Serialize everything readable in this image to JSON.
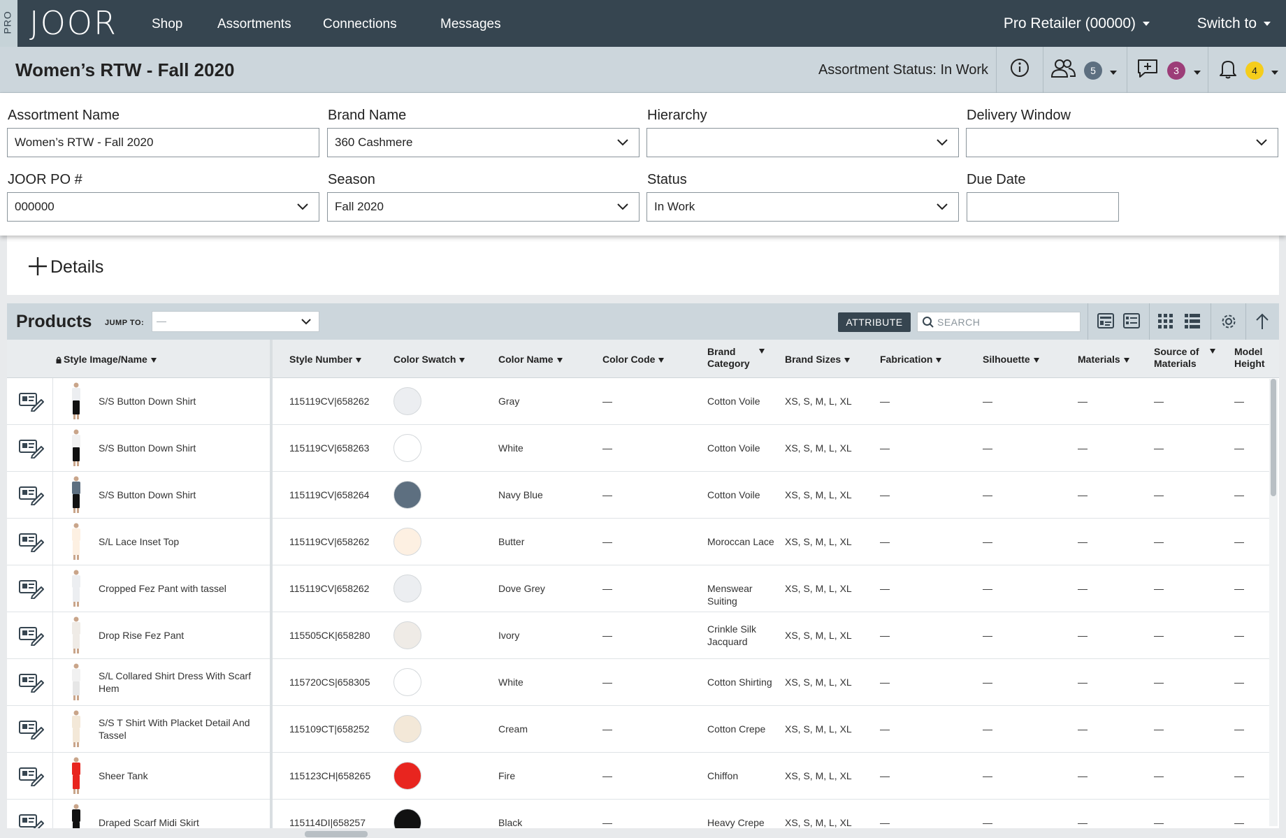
{
  "nav": {
    "pro": "PRO",
    "logo": "JOOR",
    "links": [
      "Shop",
      "Assortments",
      "Connections",
      "Messages"
    ],
    "retailer": "Pro Retailer (00000)",
    "switch": "Switch to"
  },
  "titlebar": {
    "title": "Women’s RTW - Fall 2020",
    "status": "Assortment Status: In Work",
    "users_count": "5",
    "comments_count": "3",
    "notifications_count": "4"
  },
  "form": {
    "assortment_name_label": "Assortment Name",
    "assortment_name_value": "Women’s RTW - Fall 2020",
    "brand_name_label": "Brand Name",
    "brand_name_value": "360 Cashmere",
    "hierarchy_label": "Hierarchy",
    "hierarchy_value": "",
    "delivery_window_label": "Delivery Window",
    "delivery_window_value": "",
    "po_label": "JOOR PO #",
    "po_value": "000000",
    "season_label": "Season",
    "season_value": "Fall 2020",
    "status_label": "Status",
    "status_value": "In Work",
    "due_date_label": "Due Date",
    "due_date_value": ""
  },
  "details": {
    "label": "Details"
  },
  "products": {
    "title": "Products",
    "jump_to_label": "JUMP TO:",
    "jump_to_value": "—",
    "attribute_button": "ATTRIBUTE",
    "search_placeholder": "SEARCH",
    "columns": {
      "style_image": "Style Image/Name",
      "style_number": "Style Number",
      "color_swatch": "Color Swatch",
      "color_name": "Color Name",
      "color_code": "Color Code",
      "brand_category_1": "Brand",
      "brand_category_2": "Category",
      "brand_sizes": "Brand Sizes",
      "fabrication": "Fabrication",
      "silhouette": "Silhouette",
      "materials": "Materials",
      "source_1": "Source of",
      "source_2": "Materials",
      "model_1": "Model",
      "model_2": "Height"
    },
    "rows": [
      {
        "name": "S/S Button Down Shirt",
        "style": "115119CV|658262",
        "color": "Gray",
        "code": "—",
        "cat": "Cotton Voile",
        "sizes": "XS, S, M, L, XL",
        "fab": "—",
        "sil": "—",
        "mat": "—",
        "src": "—",
        "model": "—"
      },
      {
        "name": "S/S Button Down Shirt",
        "style": "115119CV|658263",
        "color": "White",
        "code": "—",
        "cat": "Cotton Voile",
        "sizes": "XS, S, M, L, XL",
        "fab": "—",
        "sil": "—",
        "mat": "—",
        "src": "—",
        "model": "—"
      },
      {
        "name": "S/S Button Down Shirt",
        "style": "115119CV|658264",
        "color": "Navy Blue",
        "code": "—",
        "cat": "Cotton Voile",
        "sizes": "XS, S, M, L, XL",
        "fab": "—",
        "sil": "—",
        "mat": "—",
        "src": "—",
        "model": "—"
      },
      {
        "name": "S/L Lace Inset Top",
        "style": "115119CV|658262",
        "color": "Butter",
        "code": "—",
        "cat": "Moroccan Lace",
        "sizes": "XS, S, M, L, XL",
        "fab": "—",
        "sil": "—",
        "mat": "—",
        "src": "—",
        "model": "—"
      },
      {
        "name": "Cropped Fez Pant with tassel",
        "style": "115119CV|658262",
        "color": "Dove Grey",
        "code": "—",
        "cat": "Menswear Suiting",
        "sizes": "XS, S, M, L, XL",
        "fab": "—",
        "sil": "—",
        "mat": "—",
        "src": "—",
        "model": "—"
      },
      {
        "name": "Drop Rise Fez Pant",
        "style": "115505CK|658280",
        "color": "Ivory",
        "code": "—",
        "cat": "Crinkle Silk Jacquard",
        "sizes": "XS, S, M, L, XL",
        "fab": "—",
        "sil": "—",
        "mat": "—",
        "src": "—",
        "model": "—"
      },
      {
        "name": "S/L Collared Shirt Dress With Scarf Hem",
        "style": "115720CS|658305",
        "color": "White",
        "code": "—",
        "cat": "Cotton Shirting",
        "sizes": "XS, S, M, L, XL",
        "fab": "—",
        "sil": "—",
        "mat": "—",
        "src": "—",
        "model": "—"
      },
      {
        "name": "S/S T Shirt With Placket Detail And Tassel",
        "style": "115109CT|658252",
        "color": "Cream",
        "code": "—",
        "cat": "Cotton Crepe",
        "sizes": "XS, S, M, L, XL",
        "fab": "—",
        "sil": "—",
        "mat": "—",
        "src": "—",
        "model": "—"
      },
      {
        "name": "Sheer Tank",
        "style": "115123CH|658265",
        "color": "Fire",
        "code": "—",
        "cat": "Chiffon",
        "sizes": "XS, S, M, L, XL",
        "fab": "—",
        "sil": "—",
        "mat": "—",
        "src": "—",
        "model": "—"
      },
      {
        "name": "Draped Scarf Midi Skirt",
        "style": "115114DI|658257",
        "color": "Black",
        "code": "—",
        "cat": "Heavy Crepe",
        "sizes": "XS, S, M, L, XL",
        "fab": "—",
        "sil": "—",
        "mat": "—",
        "src": "—",
        "model": "—"
      }
    ],
    "swatch_colors": [
      "#eceef1",
      "#ffffff",
      "#5d6f80",
      "#fdf0e2",
      "#eceef1",
      "#efebe6",
      "#ffffff",
      "#f3e8d8",
      "#e8251f",
      "#111111"
    ]
  }
}
